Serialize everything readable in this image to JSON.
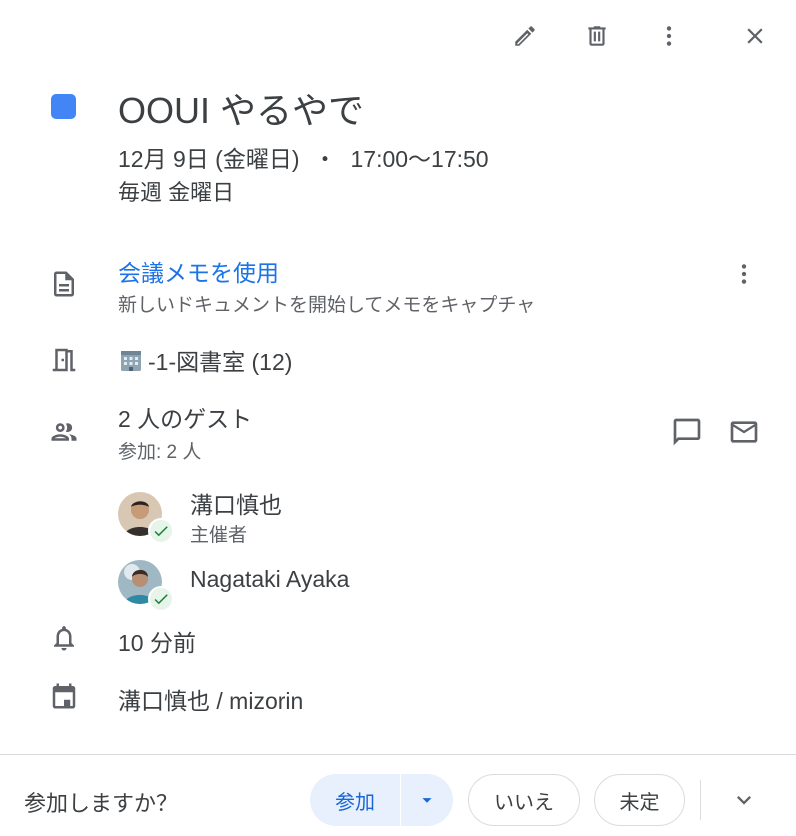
{
  "toolbar": {
    "edit_icon": "pencil-icon",
    "delete_icon": "trash-icon",
    "more_icon": "more-vert-icon",
    "close_icon": "close-icon"
  },
  "event": {
    "color": "#4285f4",
    "title": "OOUI やるやで",
    "date": "12月 9日 (金曜日)",
    "separator": "・",
    "time": "17:00〜17:50",
    "recurrence": "毎週 金曜日"
  },
  "notes": {
    "link": "会議メモを使用",
    "subtitle": "新しいドキュメントを開始してメモをキャプチャ"
  },
  "room": {
    "label": "-1-図書室 (12)"
  },
  "guests": {
    "title": "2 人のゲスト",
    "summary": "参加: 2 人",
    "list": [
      {
        "name": "溝口慎也",
        "role": "主催者"
      },
      {
        "name": "Nagataki Ayaka",
        "role": ""
      }
    ]
  },
  "reminder": {
    "text": "10 分前"
  },
  "calendar": {
    "text": "溝口慎也 / mizorin"
  },
  "rsvp": {
    "question": "参加しますか？",
    "yes": "参加",
    "no": "いいえ",
    "maybe": "未定"
  },
  "colors": {
    "accent": "#1a73e8",
    "yes_bg": "#e8f0fe",
    "accepted_check": "#188038"
  }
}
